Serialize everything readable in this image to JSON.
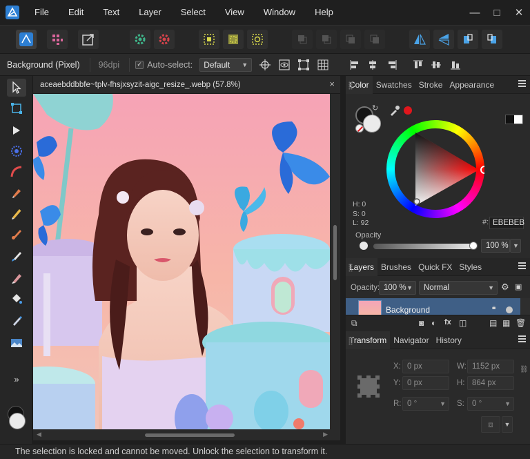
{
  "menu": {
    "items": [
      "File",
      "Edit",
      "Text",
      "Layer",
      "Select",
      "View",
      "Window",
      "Help"
    ]
  },
  "window_controls": {
    "minimize": "—",
    "restore": "□",
    "close": "✕"
  },
  "context_bar": {
    "layer_label": "Background (Pixel)",
    "dpi": "96dpi",
    "auto_select_label": "Auto-select:",
    "auto_select_checked": true,
    "auto_select_value": "Default"
  },
  "document": {
    "tab_title": "aceaebddbbfe~tplv-fhsjxsyzit-aigc_resize_.webp (57.8%)",
    "close_glyph": "×"
  },
  "color_panel": {
    "tabs": [
      "Color",
      "Swatches",
      "Stroke",
      "Appearance"
    ],
    "active_tab": "Color",
    "h": "H: 0",
    "s": "S: 0",
    "l": "L: 92",
    "hex_prefix": "#:",
    "hex_value": "EBEBEB",
    "opacity_label": "Opacity",
    "opacity_value": "100 %",
    "current_color": "#ebebeb",
    "picker_dot_color": "#e0161c"
  },
  "layers_panel": {
    "tabs": [
      "Layers",
      "Brushes",
      "Quick FX",
      "Styles"
    ],
    "active_tab": "Layers",
    "opacity_label": "Opacity:",
    "opacity_value": "100 %",
    "blend_mode": "Normal",
    "layer_name": "Background"
  },
  "transform_panel": {
    "tabs": [
      "Transform",
      "Navigator",
      "History"
    ],
    "active_tab": "Transform",
    "x_label": "X:",
    "x_value": "0 px",
    "y_label": "Y:",
    "y_value": "0 px",
    "w_label": "W:",
    "w_value": "1152 px",
    "h_label": "H:",
    "h_value": "864 px",
    "r_label": "R:",
    "r_value": "0 °",
    "s_label": "S:",
    "s_value": "0 °"
  },
  "status": {
    "message": "The selection is locked and cannot be moved. Unlock the selection to transform it."
  },
  "colors": {
    "accent": "#2d7fd3",
    "layer_row_selected": "#3f5f86"
  }
}
